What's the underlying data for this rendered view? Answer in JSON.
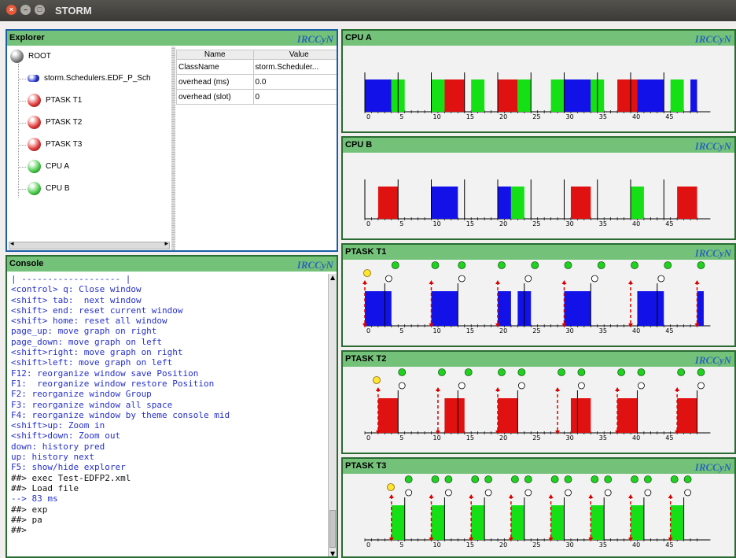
{
  "window": {
    "title": "STORM"
  },
  "explorer": {
    "title": "Explorer",
    "logo": "IRCCyN",
    "tree": [
      {
        "label": "ROOT",
        "color": "#7a7a7a"
      },
      {
        "label": "storm.Schedulers.EDF_P_Sch",
        "color": "#1e2fd0"
      },
      {
        "label": "PTASK T1",
        "color": "#e03131"
      },
      {
        "label": "PTASK T2",
        "color": "#e03131"
      },
      {
        "label": "PTASK T3",
        "color": "#e03131"
      },
      {
        "label": "CPU A",
        "color": "#3fc83f"
      },
      {
        "label": "CPU B",
        "color": "#3fc83f"
      }
    ],
    "props": {
      "headers": [
        "Name",
        "Value"
      ],
      "rows": [
        [
          "ClassName",
          "storm.Scheduler..."
        ],
        [
          "overhead (ms)",
          "0.0"
        ],
        [
          "overhead (slot)",
          "0"
        ]
      ]
    }
  },
  "console": {
    "title": "Console",
    "logo": "IRCCyN",
    "lines": [
      {
        "t": "| ------------------- |",
        "c": "#2530c8"
      },
      {
        "t": "<control> q: Close window",
        "c": "#2530c8"
      },
      {
        "t": "<shift> tab:  next window",
        "c": "#2530c8"
      },
      {
        "t": "<shift> end: reset current window",
        "c": "#2530c8"
      },
      {
        "t": "<shift> home: reset all window",
        "c": "#2530c8"
      },
      {
        "t": "page_up: move graph on right",
        "c": "#2530c8"
      },
      {
        "t": "page_down: move graph on left",
        "c": "#2530c8"
      },
      {
        "t": "<shift>right: move graph on right",
        "c": "#2530c8"
      },
      {
        "t": "<shift>left: move graph on left",
        "c": "#2530c8"
      },
      {
        "t": "F12: reorganize window save Position",
        "c": "#2530c8"
      },
      {
        "t": "F1:  reorganize window restore Position",
        "c": "#2530c8"
      },
      {
        "t": "F2: reorganize window Group",
        "c": "#2530c8"
      },
      {
        "t": "F3: reorganize window all space",
        "c": "#2530c8"
      },
      {
        "t": "F4: reorganize window by theme console mid",
        "c": "#2530c8"
      },
      {
        "t": "<shift>up: Zoom in",
        "c": "#2530c8"
      },
      {
        "t": "<shift>down: Zoom out",
        "c": "#2530c8"
      },
      {
        "t": "down: history pred",
        "c": "#2530c8"
      },
      {
        "t": "up: history next",
        "c": "#2530c8"
      },
      {
        "t": "F5: show/hide explorer",
        "c": "#2530c8"
      },
      {
        "t": "##> exec Test-EDFP2.xml",
        "c": "#111"
      },
      {
        "t": "##> Load file",
        "c": "#111"
      },
      {
        "t": "--> 83 ms",
        "c": "#2530c8"
      },
      {
        "t": "##> exp",
        "c": "#111"
      },
      {
        "t": "##> pa",
        "c": "#111"
      },
      {
        "t": "##>",
        "c": "#111"
      }
    ]
  },
  "graphs": [
    {
      "title": "CPU A",
      "logo": "IRCCyN",
      "type": "cpu",
      "bars": [
        [
          0,
          4,
          "blue"
        ],
        [
          4,
          6,
          "green"
        ],
        [
          10,
          12,
          "green"
        ],
        [
          12,
          15,
          "red"
        ],
        [
          16,
          18,
          "green"
        ],
        [
          20,
          23,
          "red"
        ],
        [
          23,
          25,
          "green"
        ],
        [
          28,
          30,
          "green"
        ],
        [
          30,
          34,
          "blue"
        ],
        [
          34,
          36,
          "green"
        ],
        [
          38,
          41,
          "red"
        ],
        [
          41,
          45,
          "blue"
        ],
        [
          46,
          48,
          "green"
        ],
        [
          49,
          50,
          "blue"
        ]
      ],
      "markers": [
        5,
        10,
        15,
        20,
        25,
        30,
        35,
        40,
        45
      ]
    },
    {
      "title": "CPU B",
      "logo": "IRCCyN",
      "type": "cpu",
      "bars": [
        [
          2,
          5,
          "red"
        ],
        [
          10,
          14,
          "blue"
        ],
        [
          20,
          22,
          "blue"
        ],
        [
          22,
          24,
          "green"
        ],
        [
          31,
          34,
          "red"
        ],
        [
          40,
          42,
          "green"
        ],
        [
          47,
          50,
          "red"
        ]
      ],
      "markers": [
        5,
        10,
        15,
        20,
        25,
        30,
        35,
        40,
        45
      ]
    },
    {
      "title": "PTASK T1",
      "logo": "IRCCyN",
      "type": "task",
      "color": "blue",
      "bars": [
        [
          0,
          4
        ],
        [
          10,
          14
        ],
        [
          20,
          22
        ],
        [
          23,
          25
        ],
        [
          30,
          34
        ],
        [
          41,
          45
        ],
        [
          50,
          51
        ]
      ],
      "arrows": [
        0,
        10,
        20,
        30,
        40,
        50
      ],
      "circles": [
        [
          4,
          "1"
        ],
        [
          10,
          "0"
        ],
        [
          14,
          "1"
        ],
        [
          20,
          "0"
        ],
        [
          25,
          "1"
        ],
        [
          30,
          "0"
        ],
        [
          35,
          "1"
        ],
        [
          40,
          "0"
        ],
        [
          45,
          "1"
        ],
        [
          50,
          "0"
        ]
      ],
      "ends": [
        3,
        14,
        24,
        34,
        44
      ]
    },
    {
      "title": "PTASK T2",
      "logo": "IRCCyN",
      "type": "task",
      "color": "red",
      "bars": [
        [
          2,
          5
        ],
        [
          12,
          15
        ],
        [
          20,
          23
        ],
        [
          31,
          34
        ],
        [
          38,
          41
        ],
        [
          47,
          50
        ]
      ],
      "arrows": [
        2,
        11,
        20,
        29,
        38,
        47
      ],
      "circles": [
        [
          5,
          "1"
        ],
        [
          11,
          "0"
        ],
        [
          15,
          "1"
        ],
        [
          20,
          "0"
        ],
        [
          23,
          "1"
        ],
        [
          29,
          "0"
        ],
        [
          32,
          "1"
        ],
        [
          38,
          "0"
        ],
        [
          41,
          "1"
        ],
        [
          47,
          "0"
        ],
        [
          50,
          "1"
        ]
      ],
      "ends": [
        5,
        14,
        23,
        32,
        41,
        50
      ]
    },
    {
      "title": "PTASK T3",
      "logo": "IRCCyN",
      "type": "task",
      "color": "green",
      "bars": [
        [
          4,
          6
        ],
        [
          10,
          12
        ],
        [
          16,
          18
        ],
        [
          22,
          24
        ],
        [
          28,
          30
        ],
        [
          34,
          36
        ],
        [
          40,
          42
        ],
        [
          46,
          48
        ]
      ],
      "arrows": [
        4,
        10,
        16,
        22,
        28,
        34,
        40,
        46
      ],
      "circles": [
        [
          6,
          "1"
        ],
        [
          10,
          "0"
        ],
        [
          12,
          "1"
        ],
        [
          16,
          "0"
        ],
        [
          18,
          "1"
        ],
        [
          22,
          "0"
        ],
        [
          24,
          "1"
        ],
        [
          28,
          "0"
        ],
        [
          30,
          "1"
        ],
        [
          34,
          "0"
        ],
        [
          36,
          "1"
        ],
        [
          40,
          "0"
        ],
        [
          42,
          "1"
        ],
        [
          46,
          "0"
        ],
        [
          48,
          "1"
        ]
      ],
      "ends": [
        6,
        12,
        18,
        24,
        30,
        36,
        42,
        48
      ]
    }
  ],
  "axis": {
    "ticks": [
      "0",
      "5",
      "10",
      "15",
      "20",
      "25",
      "30",
      "35",
      "40",
      "45"
    ]
  },
  "colors": {
    "blue": "#1212e8",
    "green": "#15e015",
    "red": "#e01111",
    "header": "#74c27a"
  }
}
